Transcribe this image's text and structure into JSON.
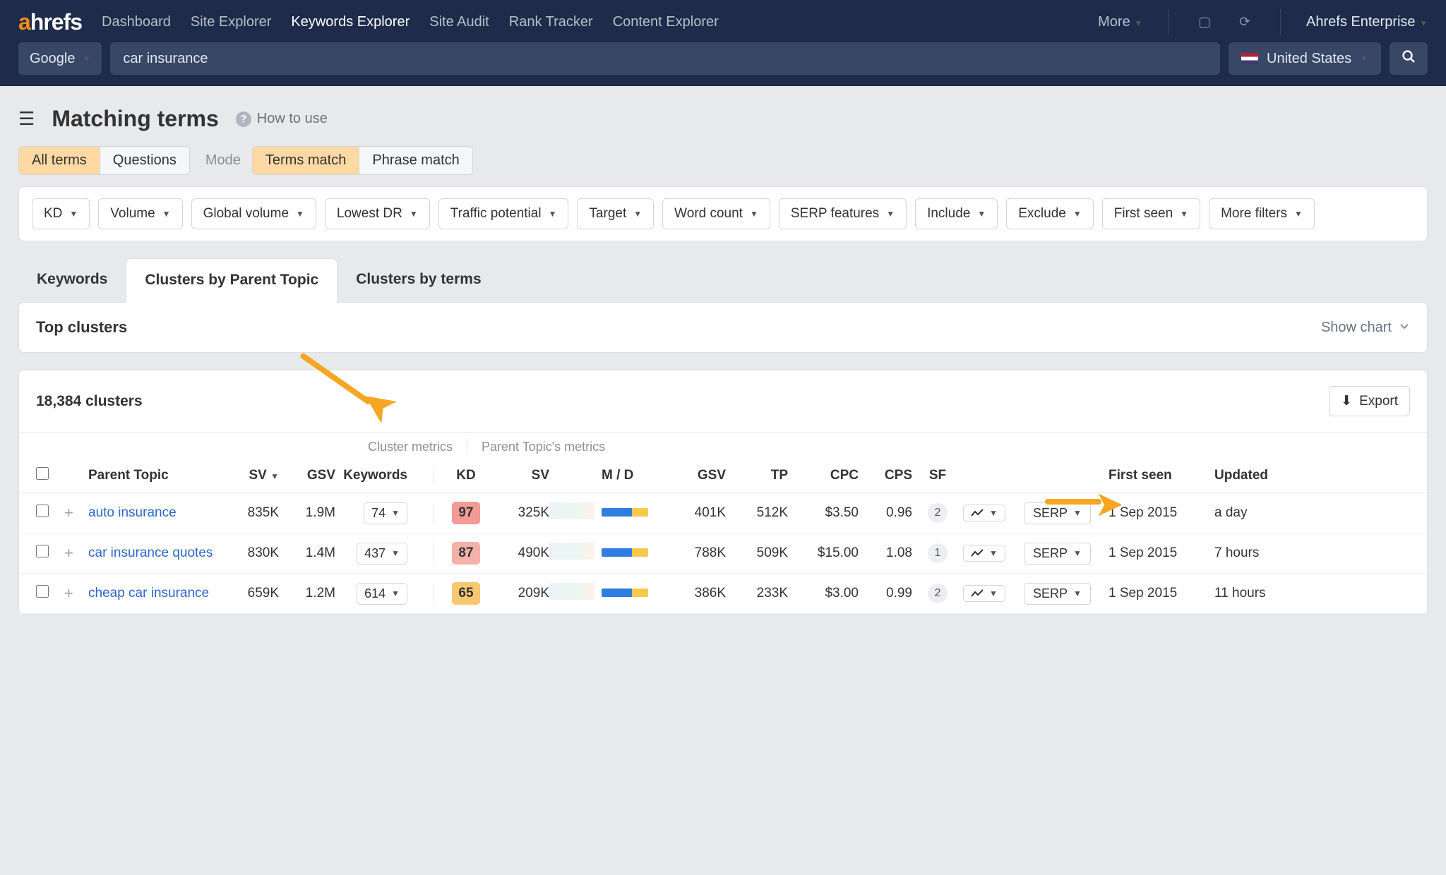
{
  "brand": {
    "a": "a",
    "rest": "hrefs"
  },
  "topnav": [
    {
      "label": "Dashboard"
    },
    {
      "label": "Site Explorer"
    },
    {
      "label": "Keywords Explorer",
      "active": true
    },
    {
      "label": "Site Audit"
    },
    {
      "label": "Rank Tracker"
    },
    {
      "label": "Content Explorer"
    }
  ],
  "more": "More",
  "account": "Ahrefs Enterprise",
  "engine": "Google",
  "query": "car insurance",
  "region": "United States",
  "page_title": "Matching terms",
  "help_label": "How to use",
  "seg_terms": [
    {
      "label": "All terms",
      "sel": true
    },
    {
      "label": "Questions"
    }
  ],
  "mode_label": "Mode",
  "seg_match": [
    {
      "label": "Terms match",
      "sel": true
    },
    {
      "label": "Phrase match"
    }
  ],
  "filters": [
    "KD",
    "Volume",
    "Global volume",
    "Lowest DR",
    "Traffic potential",
    "Target",
    "Word count",
    "SERP features",
    "Include",
    "Exclude",
    "First seen",
    "More filters"
  ],
  "view_tabs": [
    {
      "label": "Keywords"
    },
    {
      "label": "Clusters by Parent Topic",
      "active": true
    },
    {
      "label": "Clusters by terms"
    }
  ],
  "top_clusters": "Top clusters",
  "show_chart": "Show chart",
  "clusters_count": "18,384 clusters",
  "export": "Export",
  "metric_group_left": "Cluster metrics",
  "metric_group_right": "Parent Topic's metrics",
  "columns": {
    "parent_topic": "Parent Topic",
    "sv": "SV",
    "gsv": "GSV",
    "keywords": "Keywords",
    "kd": "KD",
    "sv2": "SV",
    "md": "M / D",
    "gsv2": "GSV",
    "tp": "TP",
    "cpc": "CPC",
    "cps": "CPS",
    "sf": "SF",
    "first": "First seen",
    "updated": "Updated",
    "serp": "SERP"
  },
  "rows": [
    {
      "topic": "auto insurance",
      "sv": "835K",
      "gsv": "1.9M",
      "kw": "74",
      "kd": "97",
      "kdcls": "kd-red",
      "sv2": "325K",
      "gsv2": "401K",
      "tp": "512K",
      "cpc": "$3.50",
      "cps": "0.96",
      "sf": "2",
      "first": "1 Sep 2015",
      "updated": "a day"
    },
    {
      "topic": "car insurance quotes",
      "sv": "830K",
      "gsv": "1.4M",
      "kw": "437",
      "kd": "87",
      "kdcls": "kd-pink",
      "sv2": "490K",
      "gsv2": "788K",
      "tp": "509K",
      "cpc": "$15.00",
      "cps": "1.08",
      "sf": "1",
      "first": "1 Sep 2015",
      "updated": "7 hours"
    },
    {
      "topic": "cheap car insurance",
      "sv": "659K",
      "gsv": "1.2M",
      "kw": "614",
      "kd": "65",
      "kdcls": "kd-orange",
      "sv2": "209K",
      "gsv2": "386K",
      "tp": "233K",
      "cpc": "$3.00",
      "cps": "0.99",
      "sf": "2",
      "first": "1 Sep 2015",
      "updated": "11 hours"
    }
  ]
}
